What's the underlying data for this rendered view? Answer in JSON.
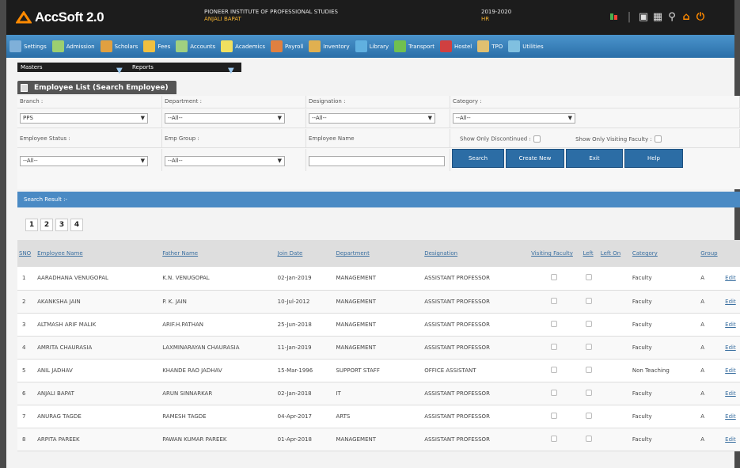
{
  "app": {
    "title": "AccSoft 2.0"
  },
  "header": {
    "institute": "PIONEER INSTITUTE OF PROFESSIONAL STUDIES",
    "user": "ANJALI BAPAT",
    "year": "2019-2020",
    "year_sub": "HR"
  },
  "top_icons": [
    "lights-icon",
    "divider-icon",
    "home-icon",
    "print-icon",
    "tools-icon",
    "home-alt-icon",
    "power-icon"
  ],
  "menu": [
    {
      "label": "Settings",
      "color": "#7fb0d9"
    },
    {
      "label": "Admission",
      "color": "#9ccf70"
    },
    {
      "label": "Scholars",
      "color": "#e0a040"
    },
    {
      "label": "Fees",
      "color": "#f0c040"
    },
    {
      "label": "Accounts",
      "color": "#a0d080"
    },
    {
      "label": "Academics",
      "color": "#f0e060"
    },
    {
      "label": "Payroll",
      "color": "#e08040"
    },
    {
      "label": "Inventory",
      "color": "#e0b050"
    },
    {
      "label": "Library",
      "color": "#60b0e0"
    },
    {
      "label": "Transport",
      "color": "#70c050"
    },
    {
      "label": "Hostel",
      "color": "#d04040"
    },
    {
      "label": "TPO",
      "color": "#e0c070"
    },
    {
      "label": "Utilities",
      "color": "#80c0e0"
    }
  ],
  "submenu": {
    "masters": "Masters",
    "reports": "Reports"
  },
  "page_title": "Employee List (Search Employee)",
  "filters": {
    "branch_label": "Branch :",
    "branch_value": "PPS",
    "department_label": "Department :",
    "department_value": "--All--",
    "designation_label": "Designation :",
    "designation_value": "--All--",
    "category_label": "Category :",
    "category_value": "--All--",
    "status_label": "Employee Status :",
    "status_value": "--All--",
    "group_label": "Emp Group :",
    "group_value": "--All--",
    "name_label": "Employee Name",
    "discontinued_label": "Show Only Discontinued :",
    "visiting_label": "Show Only Visiting Faculty :"
  },
  "buttons": {
    "search": "Search",
    "create": "Create New",
    "exit": "Exit",
    "help": "Help"
  },
  "result_label": "Search Result :-",
  "pages": [
    "1",
    "2",
    "3",
    "4"
  ],
  "columns": [
    "SNO",
    "Employee Name",
    "Father Name",
    "Join Date",
    "Department",
    "Designation",
    "Visiting Faculty",
    "Left",
    "Left On",
    "Category",
    "Group"
  ],
  "rows": [
    {
      "sno": "1",
      "name": "AARADHANA VENUGOPAL",
      "father": "K.N. VENUGOPAL",
      "join": "02-Jan-2019",
      "dept": "MANAGEMENT",
      "desig": "ASSISTANT PROFESSOR",
      "category": "Faculty",
      "group": "A",
      "edit": "Edit"
    },
    {
      "sno": "2",
      "name": "AKANKSHA JAIN",
      "father": "P. K. JAIN",
      "join": "10-Jul-2012",
      "dept": "MANAGEMENT",
      "desig": "ASSISTANT PROFESSOR",
      "category": "Faculty",
      "group": "A",
      "edit": "Edit"
    },
    {
      "sno": "3",
      "name": "ALTMASH ARIF MALIK",
      "father": "ARIF.H.PATHAN",
      "join": "25-Jun-2018",
      "dept": "MANAGEMENT",
      "desig": "ASSISTANT PROFESSOR",
      "category": "Faculty",
      "group": "A",
      "edit": "Edit"
    },
    {
      "sno": "4",
      "name": "AMRITA CHAURASIA",
      "father": "LAXMINARAYAN CHAURASIA",
      "join": "11-Jan-2019",
      "dept": "MANAGEMENT",
      "desig": "ASSISTANT PROFESSOR",
      "category": "Faculty",
      "group": "A",
      "edit": "Edit"
    },
    {
      "sno": "5",
      "name": "ANIL JADHAV",
      "father": "KHANDE RAO JADHAV",
      "join": "15-Mar-1996",
      "dept": "SUPPORT STAFF",
      "desig": "OFFICE ASSISTANT",
      "category": "Non Teaching",
      "group": "A",
      "edit": "Edit"
    },
    {
      "sno": "6",
      "name": "ANJALI BAPAT",
      "father": "ARUN SINNARKAR",
      "join": "02-Jan-2018",
      "dept": "IT",
      "desig": "ASSISTANT PROFESSOR",
      "category": "Faculty",
      "group": "A",
      "edit": "Edit"
    },
    {
      "sno": "7",
      "name": "ANURAG TAGDE",
      "father": "RAMESH TAGDE",
      "join": "04-Apr-2017",
      "dept": "ARTS",
      "desig": "ASSISTANT PROFESSOR",
      "category": "Faculty",
      "group": "A",
      "edit": "Edit"
    },
    {
      "sno": "8",
      "name": "ARPITA PAREEK",
      "father": "PAWAN KUMAR PAREEK",
      "join": "01-Apr-2018",
      "dept": "MANAGEMENT",
      "desig": "ASSISTANT PROFESSOR",
      "category": "Faculty",
      "group": "A",
      "edit": "Edit"
    }
  ]
}
